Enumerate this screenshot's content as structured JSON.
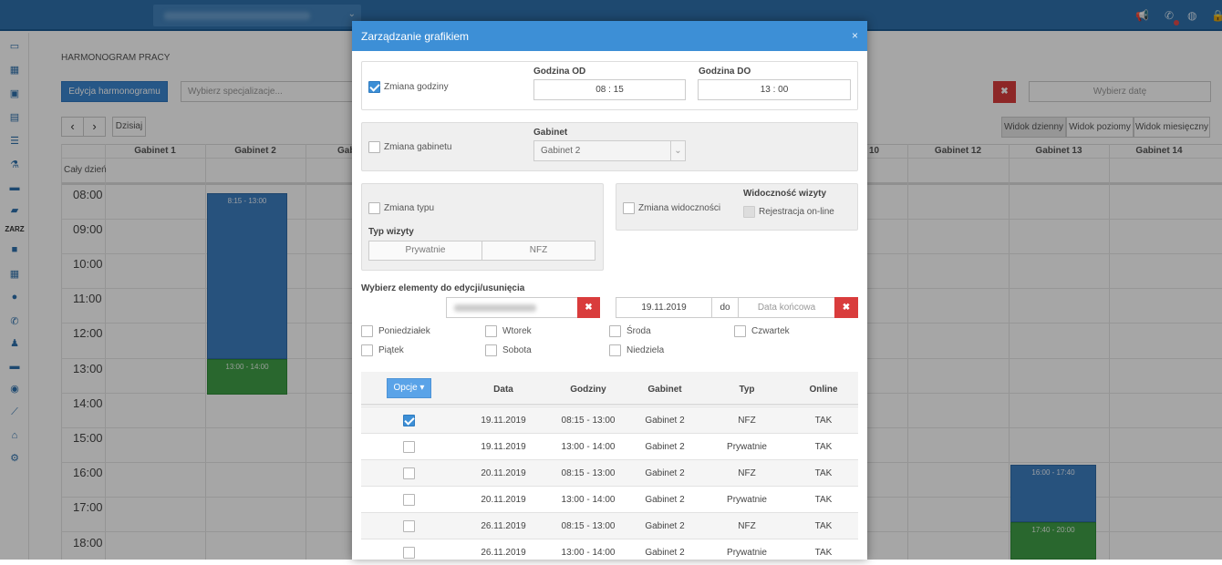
{
  "page": {
    "section_title": "HARMONOGRAM PRACY",
    "edit_button": "Edycja harmonogramu",
    "spec_placeholder": "Wybierz specjalizacje...",
    "date_picker": "Wybierz datę",
    "today_button": "Dzisiaj",
    "all_day_label": "Cały dzień",
    "sidebar_label": "ZARZ",
    "views": [
      "Widok dzienny",
      "Widok poziomy",
      "Widok miesięczny"
    ],
    "clear_icon": "✖"
  },
  "calendar": {
    "columns": [
      "Gabinet 1",
      "Gabinet 2",
      "Gab",
      "10",
      "Gabinet 12",
      "Gabinet 13",
      "Gabinet 14"
    ],
    "hours": [
      "08:00",
      "09:00",
      "10:00",
      "11:00",
      "12:00",
      "13:00",
      "14:00",
      "15:00",
      "16:00",
      "17:00",
      "18:00"
    ],
    "events": [
      {
        "time": "8:15 - 13:00",
        "color": "#3d7ec0"
      },
      {
        "time": "13:00 - 14:00",
        "color": "#3f9e47"
      },
      {
        "time": "16:00 - 17:40",
        "color": "#3d7ec0"
      },
      {
        "time": "17:40 - 20:00",
        "color": "#3f9e47"
      }
    ]
  },
  "modal": {
    "title": "Zarządzanie grafikiem",
    "close": "×",
    "change_hours": {
      "label": "Zmiana godziny",
      "checked": true
    },
    "hour_from": {
      "label": "Godzina OD",
      "value": "08 : 15"
    },
    "hour_to": {
      "label": "Godzina DO",
      "value": "13 : 00"
    },
    "change_room": {
      "label": "Zmiana gabinetu",
      "checked": false
    },
    "room": {
      "label": "Gabinet",
      "value": "Gabinet 2"
    },
    "change_type": {
      "label": "Zmiana typu",
      "checked": false
    },
    "visit_type": {
      "label": "Typ wizyty",
      "options": [
        "Prywatnie",
        "NFZ"
      ]
    },
    "change_visibility": {
      "label": "Zmiana widoczności",
      "checked": false
    },
    "visibility": {
      "label": "Widoczność wizyty",
      "option": "Rejestracja on-line"
    },
    "select_elements": "Wybierz elementy do edycji/usunięcia",
    "date_from": "19.11.2019",
    "date_sep": "do",
    "date_to_placeholder": "Data końcowa",
    "days": [
      "Poniedziałek",
      "Wtorek",
      "Środa",
      "Czwartek",
      "Piątek",
      "Sobota",
      "Niedziela"
    ],
    "options_button": "Opcje",
    "table_headers": [
      "Data",
      "Godziny",
      "Gabinet",
      "Typ",
      "Online"
    ],
    "rows": [
      {
        "checked": true,
        "date": "19.11.2019",
        "hours": "08:15 - 13:00",
        "room": "Gabinet 2",
        "type": "NFZ",
        "online": "TAK"
      },
      {
        "checked": false,
        "date": "19.11.2019",
        "hours": "13:00 - 14:00",
        "room": "Gabinet 2",
        "type": "Prywatnie",
        "online": "TAK"
      },
      {
        "checked": false,
        "date": "20.11.2019",
        "hours": "08:15 - 13:00",
        "room": "Gabinet 2",
        "type": "NFZ",
        "online": "TAK"
      },
      {
        "checked": false,
        "date": "20.11.2019",
        "hours": "13:00 - 14:00",
        "room": "Gabinet 2",
        "type": "Prywatnie",
        "online": "TAK"
      },
      {
        "checked": false,
        "date": "26.11.2019",
        "hours": "08:15 - 13:00",
        "room": "Gabinet 2",
        "type": "NFZ",
        "online": "TAK"
      },
      {
        "checked": false,
        "date": "26.11.2019",
        "hours": "13:00 - 14:00",
        "room": "Gabinet 2",
        "type": "Prywatnie",
        "online": "TAK"
      }
    ]
  }
}
